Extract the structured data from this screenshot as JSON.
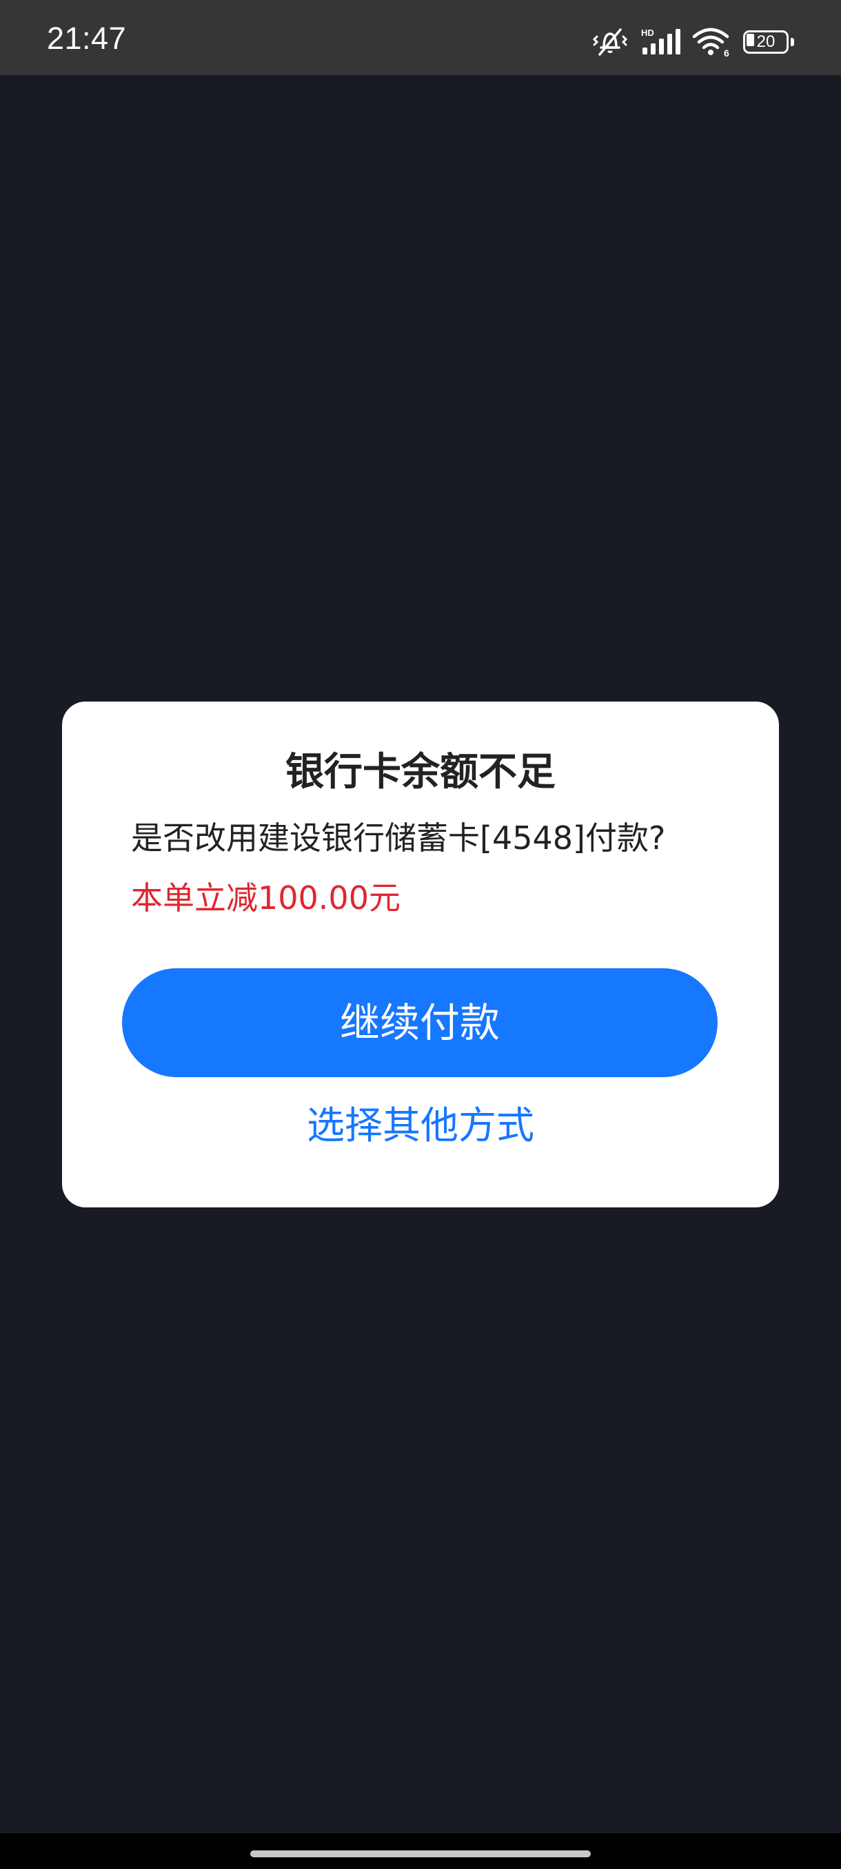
{
  "status_bar": {
    "time": "21:47",
    "icons": [
      "mute-vibrate-icon",
      "hd-signal-icon",
      "wifi-6-icon",
      "battery-icon"
    ],
    "hd_label": "HD",
    "wifi_label": "6",
    "battery_level": "20",
    "battery_fraction": 0.2
  },
  "dialog": {
    "title": "银行卡余额不足",
    "message": "是否改用建设银行储蓄卡[4548]付款?",
    "discount": "本单立减100.00元",
    "primary_button": "继续付款",
    "secondary_link": "选择其他方式"
  },
  "colors": {
    "background": "#181a24",
    "status_bar": "#363636",
    "primary": "#1677ff",
    "discount": "#e0262e"
  }
}
